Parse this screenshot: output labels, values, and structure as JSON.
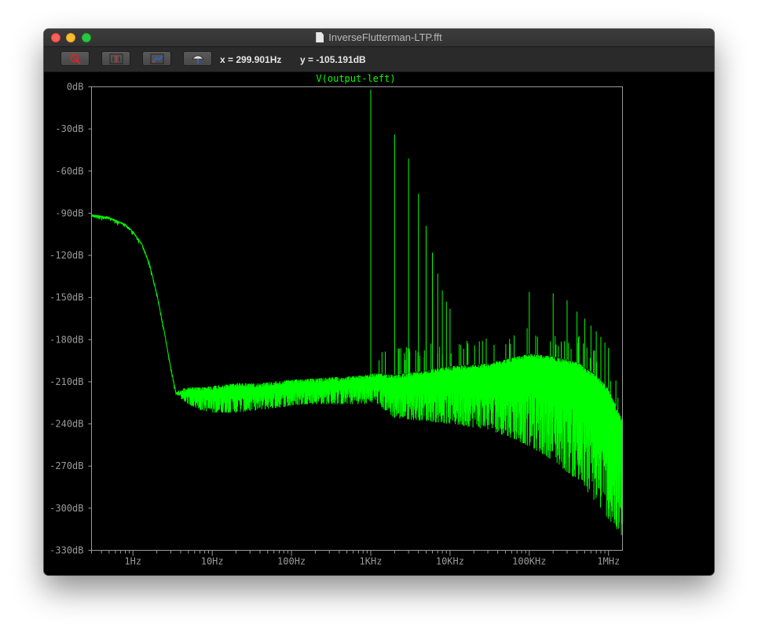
{
  "window": {
    "title": "InverseFlutterman-LTP.fft"
  },
  "toolbar": {
    "buttons": [
      {
        "icon": "magnifier-no-icon",
        "label": ""
      },
      {
        "icon": "autorange-icon",
        "label": ""
      },
      {
        "icon": "zoom-back-icon",
        "label": ""
      },
      {
        "icon": "umbrella-icon",
        "label": ""
      }
    ],
    "x_readout": "x = 299.901Hz",
    "y_readout": "y = -105.191dB"
  },
  "colors": {
    "trace": "#00ff00",
    "background": "#000000",
    "axis": "#9a9a9a"
  },
  "chart_data": {
    "type": "line",
    "title": "V(output-left)",
    "xscale": "log",
    "xlim": [
      0.3,
      1500000
    ],
    "ylim": [
      -330,
      0
    ],
    "x_ticks": [
      {
        "value": 1,
        "label": "1Hz"
      },
      {
        "value": 10,
        "label": "10Hz"
      },
      {
        "value": 100,
        "label": "100Hz"
      },
      {
        "value": 1000,
        "label": "1KHz"
      },
      {
        "value": 10000,
        "label": "10KHz"
      },
      {
        "value": 100000,
        "label": "100KHz"
      },
      {
        "value": 1000000,
        "label": "1MHz"
      }
    ],
    "y_ticks": [
      {
        "value": 0,
        "label": "0dB"
      },
      {
        "value": -30,
        "label": "-30dB"
      },
      {
        "value": -60,
        "label": "-60dB"
      },
      {
        "value": -90,
        "label": "-90dB"
      },
      {
        "value": -120,
        "label": "-120dB"
      },
      {
        "value": -150,
        "label": "-150dB"
      },
      {
        "value": -180,
        "label": "-180dB"
      },
      {
        "value": -210,
        "label": "-210dB"
      },
      {
        "value": -240,
        "label": "-240dB"
      },
      {
        "value": -270,
        "label": "-270dB"
      },
      {
        "value": -300,
        "label": "-300dB"
      },
      {
        "value": -330,
        "label": "-330dB"
      }
    ],
    "series": [
      {
        "name": "V(output-left)",
        "envelope": {
          "x": [
            0.3,
            0.5,
            0.8,
            1.0,
            1.3,
            1.6,
            2.0,
            2.5,
            3.0,
            3.5,
            4.0,
            5,
            7,
            10,
            20,
            40,
            80,
            150,
            300,
            600,
            900,
            1100,
            2000,
            5000,
            10000,
            30000,
            60000,
            100000,
            200000,
            400000,
            700000,
            1000000,
            1500000
          ],
          "y_high": [
            -91,
            -93,
            -98,
            -103,
            -112,
            -125,
            -147,
            -175,
            -200,
            -218,
            -215,
            -214,
            -214,
            -213,
            -211,
            -211,
            -209,
            -208,
            -207,
            -206,
            -205,
            -204,
            -205,
            -202,
            -199,
            -197,
            -193,
            -190,
            -192,
            -196,
            -205,
            -215,
            -238
          ],
          "y_low": [
            -91,
            -93,
            -98,
            -103,
            -112,
            -125,
            -147,
            -175,
            -200,
            -218,
            -222,
            -226,
            -230,
            -232,
            -232,
            -230,
            -228,
            -226,
            -226,
            -226,
            -226,
            -224,
            -236,
            -238,
            -240,
            -244,
            -250,
            -256,
            -266,
            -280,
            -296,
            -308,
            -322
          ]
        },
        "harmonics": [
          {
            "x": 1000,
            "y": -2
          },
          {
            "x": 2000,
            "y": -34
          },
          {
            "x": 3000,
            "y": -51
          },
          {
            "x": 4000,
            "y": -76
          },
          {
            "x": 5000,
            "y": -99
          },
          {
            "x": 6000,
            "y": -118
          },
          {
            "x": 7000,
            "y": -133
          },
          {
            "x": 8000,
            "y": -145
          },
          {
            "x": 9000,
            "y": -153
          },
          {
            "x": 10000,
            "y": -158
          },
          {
            "x": 100000,
            "y": -146
          },
          {
            "x": 200000,
            "y": -147
          },
          {
            "x": 300000,
            "y": -152
          },
          {
            "x": 400000,
            "y": -160
          },
          {
            "x": 500000,
            "y": -165
          },
          {
            "x": 600000,
            "y": -170
          },
          {
            "x": 700000,
            "y": -174
          },
          {
            "x": 800000,
            "y": -178
          },
          {
            "x": 900000,
            "y": -182
          },
          {
            "x": 1000000,
            "y": -186
          }
        ]
      }
    ]
  }
}
